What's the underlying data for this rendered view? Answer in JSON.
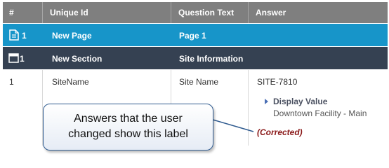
{
  "table": {
    "headers": [
      "#",
      "Unique Id",
      "Question Text",
      "Answer"
    ],
    "page_row": {
      "number": "1",
      "unique_id": "New Page",
      "question_text": "Page 1",
      "icon": "page-icon"
    },
    "section_row": {
      "number": "1",
      "unique_id": "New Section",
      "question_text": "Site Information",
      "icon": "section-icon"
    },
    "data_row": {
      "number": "1",
      "unique_id": "SiteName",
      "question_text": "Site Name",
      "answer": "SITE-7810",
      "display_label": "Display Value",
      "display_value": "Downtown Facility - Main",
      "corrected_label": "(Corrected)"
    }
  },
  "callout": {
    "line1": "Answers that the user",
    "line2": "changed show this label"
  },
  "colors": {
    "header": "#7f7f7f",
    "page_row": "#1795c9",
    "section_row": "#354152",
    "corrected": "#8b1a1a",
    "callout_border": "#2e5a8f"
  }
}
